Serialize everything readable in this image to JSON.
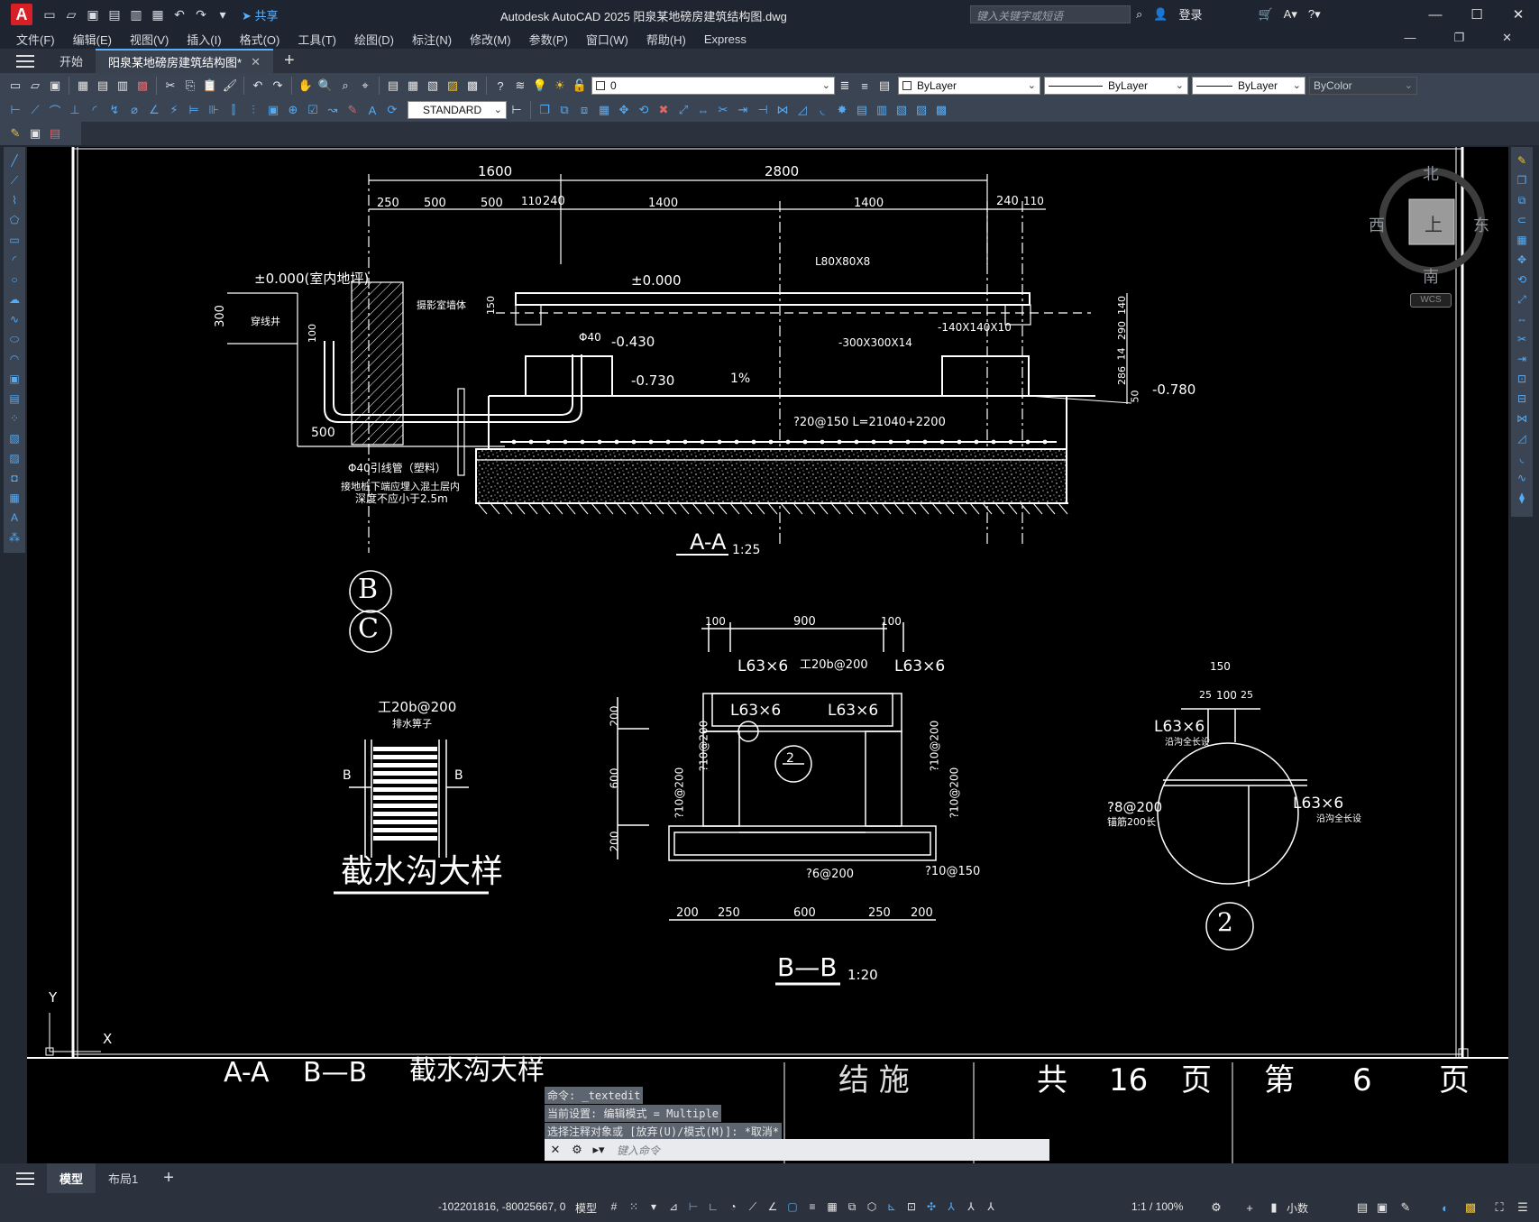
{
  "app": {
    "title": "Autodesk AutoCAD 2025    阳泉某地磅房建筑结构图.dwg",
    "logo": "A",
    "share_label": "共享",
    "search_placeholder": "键入关键字或短语",
    "login_label": "登录"
  },
  "menu": [
    "文件(F)",
    "编辑(E)",
    "视图(V)",
    "插入(I)",
    "格式(O)",
    "工具(T)",
    "绘图(D)",
    "标注(N)",
    "修改(M)",
    "参数(P)",
    "窗口(W)",
    "帮助(H)",
    "Express"
  ],
  "tabs": {
    "start": "开始",
    "doc": "阳泉某地磅房建筑结构图*"
  },
  "toolbar": {
    "layer_value": "0",
    "text_style": "STANDARD",
    "color": "ByLayer",
    "linetype": "ByLayer",
    "lineweight": "ByLayer",
    "plotstyle": "ByColor"
  },
  "compass": {
    "north": "北",
    "south": "南",
    "east": "东",
    "west": "西",
    "top": "上",
    "wcs": "WCS"
  },
  "drawing": {
    "dim_top_1600": "1600",
    "dim_top_2800": "2800",
    "dims_row": [
      "250",
      "500",
      "500",
      "110",
      "240",
      "1400",
      "1400",
      "240",
      "110"
    ],
    "elev_indoor": "±0.000(室内地坪)",
    "elev_0": "±0.000",
    "elev_430": "-0.430",
    "elev_730": "-0.730",
    "elev_780": "-0.780",
    "slope": "1%",
    "angle_steel": "L80X80X8",
    "plate_140": "-140X140X10",
    "plate_300": "-300X300X14",
    "phi40": "Φ40",
    "rebar_note": "?20@150  L=21040+2200",
    "dim_300": "300",
    "dim_100": "100",
    "dim_500": "500",
    "dim_right": [
      "140",
      "290",
      "14",
      "286",
      "50"
    ],
    "dim_150": "150",
    "label_well": "穿线井",
    "label_wall": "摄影室墙体",
    "pipe_note": "Φ40引线管（塑料）",
    "ground_note_1": "接地桩下端应埋入混土层内",
    "ground_note_2": "深度不应小于2.5m",
    "section_aa": "A-A",
    "scale_aa": "1:25",
    "axis_b": "B",
    "axis_c": "C",
    "grate_label": "工20b@200",
    "grate_sub": "排水箅子",
    "grate_b": "B",
    "trench_title": "截水沟大样",
    "bb_dims_top": [
      "100",
      "900",
      "100"
    ],
    "bb_l63_a": "L63×6",
    "bb_l63_b": "L63×6",
    "bb_l63_c": "L63×6",
    "bb_l63_d": "L63×6",
    "bb_beam": "工20b@200",
    "bb_left_dims": [
      "200",
      "600",
      "200"
    ],
    "bb_r1": "?10@200",
    "bb_r2": "?10@200",
    "bb_r3": "?10@200",
    "bb_r4": "?10@200",
    "bb_r6": "?6@200",
    "bb_r10": "?10@150",
    "bb_bottom_dims": [
      "200",
      "250",
      "600",
      "250",
      "200"
    ],
    "bb_callout": "2",
    "section_bb": "B—B",
    "scale_bb": "1:20",
    "det_dims": [
      "150",
      "25",
      "100",
      "25"
    ],
    "det_l63_a": "L63×6",
    "det_l63_a_sub": "沿沟全长设",
    "det_l63_b": "L63×6",
    "det_l63_b_sub": "沿沟全长设",
    "det_rebar": "?8@200",
    "det_rebar_sub": "锚筋200长",
    "det_num": "2",
    "ucs_y": "Y",
    "ucs_x": "X",
    "title_block": [
      "A-A",
      "B—B",
      "截水沟大样",
      "结  施",
      "共",
      "16",
      "页",
      "第",
      "6",
      "页"
    ]
  },
  "command": {
    "history": [
      "命令: _textedit",
      "当前设置: 编辑模式 = Multiple",
      "选择注释对象或 [放弃(U)/模式(M)]: *取消*"
    ],
    "placeholder": "键入命令"
  },
  "layouts": {
    "model": "模型",
    "layout1": "布局1"
  },
  "status": {
    "coords": "-102201816, -80025667, 0",
    "mode": "模型",
    "scale": "1:1 / 100%",
    "units": "小数"
  }
}
